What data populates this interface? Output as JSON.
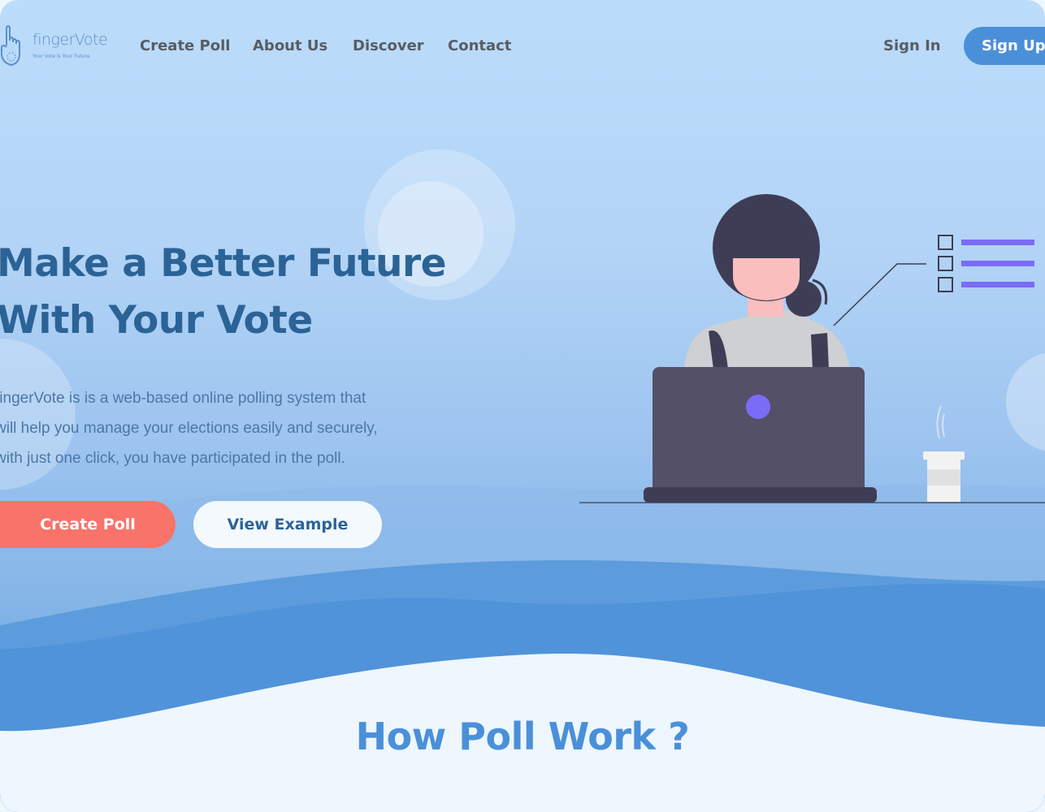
{
  "brand": {
    "name": "fingerVote",
    "tagline": "Your Vote is Your Future"
  },
  "nav": {
    "links": [
      "Create Poll",
      "About Us",
      "Discover",
      "Contact"
    ],
    "sign_in": "Sign In",
    "sign_up": "Sign Up"
  },
  "hero": {
    "title_line1": "Make a Better Future",
    "title_line2": "With Your Vote",
    "desc_line1": "fingerVote is is a web-based online polling system that",
    "desc_line2": "will help you manage your elections easily and securely,",
    "desc_line3": "with just one click, you have participated in the poll.",
    "primary_button": "Create Poll",
    "secondary_button": "View Example"
  },
  "section": {
    "title": "How Poll Work ?"
  },
  "colors": {
    "accent": "#4a90d9",
    "heading": "#2c6396",
    "cta": "#f8736a",
    "nav_text": "#585d63",
    "checklist": "#7b6cf6"
  },
  "icons": {
    "logo": "hand-finger-icon",
    "illustration": "woman-laptop-voting"
  }
}
